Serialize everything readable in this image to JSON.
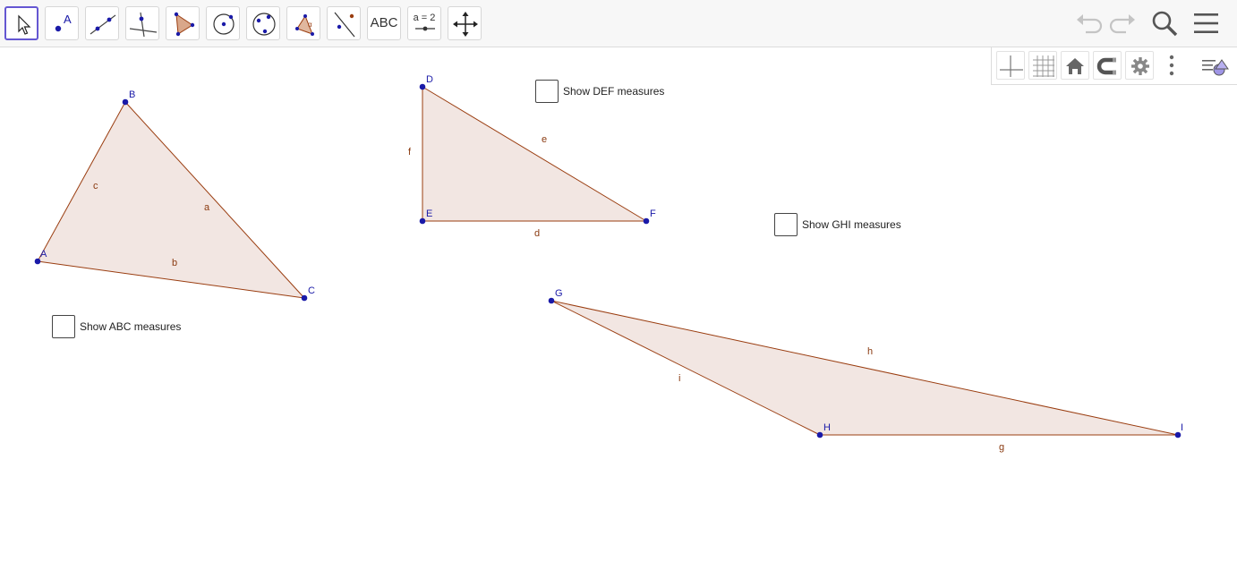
{
  "toolbar": {
    "tools": [
      {
        "name": "move-tool"
      },
      {
        "name": "point-tool"
      },
      {
        "name": "line-tool"
      },
      {
        "name": "perpendicular-line-tool"
      },
      {
        "name": "polygon-tool"
      },
      {
        "name": "circle-tool"
      },
      {
        "name": "conic-tool"
      },
      {
        "name": "angle-tool"
      },
      {
        "name": "reflect-tool"
      },
      {
        "name": "text-tool",
        "label": "ABC"
      },
      {
        "name": "slider-tool",
        "label": "a = 2"
      },
      {
        "name": "move-graphics-view-tool"
      }
    ],
    "header_icons": [
      "undo-icon",
      "redo-icon",
      "search-icon",
      "menu-icon"
    ]
  },
  "style_bar": {
    "icons": [
      "axes-icon",
      "grid-icon",
      "home-icon",
      "point-capturing-icon",
      "settings-icon",
      "more-icon",
      "toggle-style-bar-icon"
    ]
  },
  "geometry": {
    "triangle_abc": {
      "points": {
        "A": "A",
        "B": "B",
        "C": "C"
      },
      "segments": {
        "a": "a",
        "b": "b",
        "c": "c"
      },
      "checkbox_label": "Show ABC measures"
    },
    "triangle_def": {
      "points": {
        "D": "D",
        "E": "E",
        "F": "F"
      },
      "segments": {
        "d": "d",
        "e": "e",
        "f": "f"
      },
      "checkbox_label": "Show DEF measures"
    },
    "triangle_ghi": {
      "points": {
        "G": "G",
        "H": "H",
        "I": "I"
      },
      "segments": {
        "g": "g",
        "h": "h",
        "i": "i"
      },
      "checkbox_label": "Show GHI measures"
    }
  },
  "colors": {
    "polygon_fill": "#f2e6e2",
    "polygon_stroke": "#9a3d10",
    "point": "#1a1aa8",
    "label_point": "#1a1aa8",
    "label_segment": "#8a3a10",
    "active_tool": "#6557d2"
  }
}
